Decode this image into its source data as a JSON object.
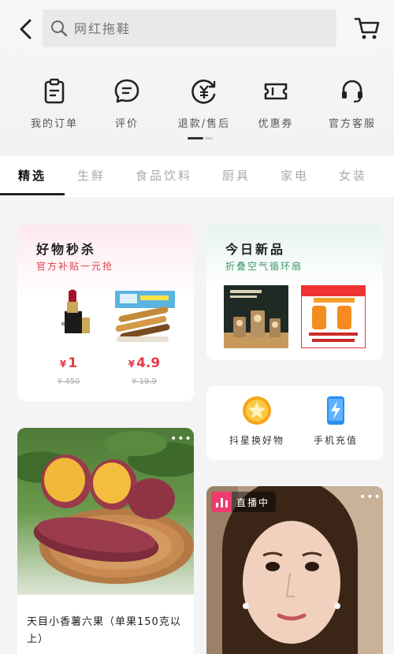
{
  "search": {
    "placeholder": "网红拖鞋"
  },
  "quick_links": [
    {
      "label": "我的订单",
      "icon": "clipboard-icon"
    },
    {
      "label": "评价",
      "icon": "chat-bubble-icon"
    },
    {
      "label": "退款/售后",
      "icon": "refund-yen-icon"
    },
    {
      "label": "优惠券",
      "icon": "coupon-ticket-icon"
    },
    {
      "label": "官方客服",
      "icon": "headset-icon"
    }
  ],
  "tabs": [
    "精选",
    "生鲜",
    "食品饮料",
    "厨具",
    "家电",
    "女装"
  ],
  "flash_sale": {
    "title": "好物秒杀",
    "subtitle": "官方补贴一元抢",
    "items": [
      {
        "name": "lipstick",
        "currency": "¥",
        "price": "1",
        "original": "¥ 450"
      },
      {
        "name": "egg rolls",
        "currency": "¥",
        "price": "4.9",
        "original": "¥ 19.9"
      }
    ]
  },
  "new_today": {
    "title": "今日新品",
    "subtitle": "折叠空气循环扇"
  },
  "services": [
    {
      "label": "抖星换好物",
      "icon": "star-badge-icon"
    },
    {
      "label": "手机充值",
      "icon": "phone-charge-icon"
    }
  ],
  "feed": {
    "product_title": "天目小香薯六果（单果150克以上）",
    "live_label": "直播中",
    "more": "•••"
  },
  "colors": {
    "accent_red": "#e23d4a",
    "accent_green": "#3c9a6a",
    "live_pink": "#ee3b6e"
  }
}
